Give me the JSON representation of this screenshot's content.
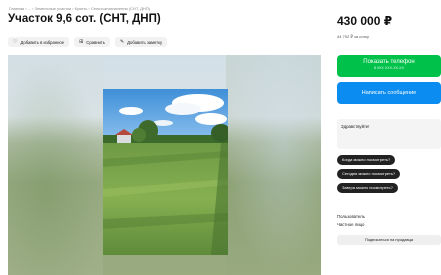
{
  "breadcrumbs": "Главная › ... › Земельные участки › Купить › Сельхозназначения (СНТ, ДНП)",
  "title": "Участок 9,6 сот. (СНТ, ДНП)",
  "actions": {
    "favorite": {
      "label": "Добавить в избранное",
      "icon": "heart-icon"
    },
    "compare": {
      "label": "Сравнить",
      "icon": "compare-icon"
    },
    "note": {
      "label": "Добавить заметку",
      "icon": "note-icon"
    }
  },
  "price": "430 000 ₽",
  "price_per_sotka": "44 792 ₽ за сотку",
  "contact": {
    "phone_label": "Показать телефон",
    "phone_masked": "8 9XX XXX-XX-XX",
    "message_label": "Написать сообщение"
  },
  "message_box": {
    "text": "Здравствуйте!"
  },
  "quick_questions": [
    "Когда можно посмотреть?",
    "Сегодня можно посмотреть?",
    "Завтра можно посмотреть?"
  ],
  "seller": {
    "role": "Пользователь",
    "type": "Частное лицо",
    "subscribe_label": "Подписаться на продавца"
  },
  "colors": {
    "phone_button": "#00c24a",
    "message_button": "#0a8cf0",
    "chip": "#222222"
  }
}
